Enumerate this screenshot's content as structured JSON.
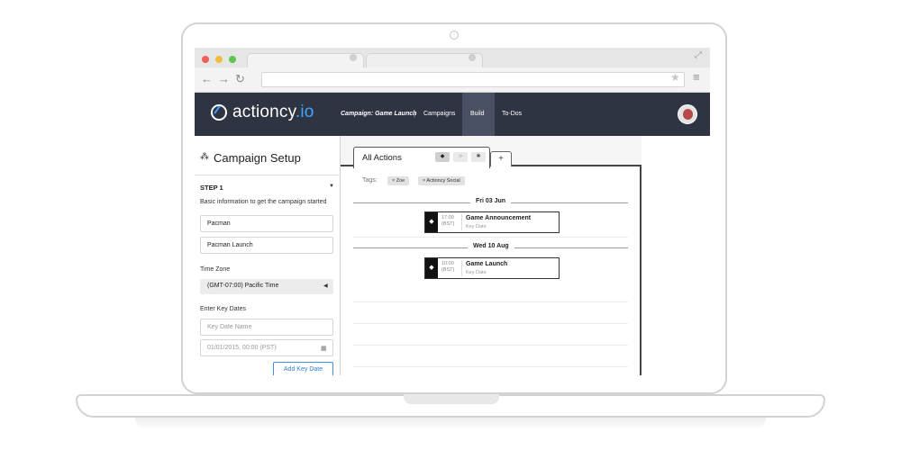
{
  "browser": {
    "nav": {
      "back": "←",
      "forward": "→",
      "reload": "↻"
    },
    "icons": {
      "bookmark": "star-icon",
      "menu": "hamburger-icon",
      "expand": "expand-icon"
    }
  },
  "header": {
    "logo_main": "actioncy",
    "logo_suffix": ".io",
    "breadcrumb": "Campaign: Game Launch",
    "separator": "|",
    "nav": [
      "Campaigns",
      "Build",
      "To-Dos"
    ],
    "active_nav": "Build"
  },
  "sidebar": {
    "title": "Campaign Setup",
    "step_label": "STEP 1",
    "hint": "Basic information to get the campaign started",
    "fields": {
      "name_value": "Pacman",
      "campaign_value": "Pacman Launch"
    },
    "timezone_label": "Time Zone",
    "timezone_value": "(GMT-07:00) Pacific Time",
    "key_dates_label": "Enter Key Dates",
    "key_date_name_placeholder": "Key Date Name",
    "key_date_datetime_placeholder": "01/01/2015, 00:00 (PST)",
    "add_button": "Add Key Date"
  },
  "main": {
    "tab_title": "All Actions",
    "tab_plus": "+",
    "tags_label": "Tags:",
    "tags": [
      "× Zoe",
      "× Actioncy Social"
    ],
    "groups": [
      {
        "date": "Fri 03 Jun",
        "actions": [
          {
            "time": "17:00",
            "zone": "(BST)",
            "title": "Game Announcement",
            "type": "Key Date"
          }
        ]
      },
      {
        "date": "Wed 10 Aug",
        "actions": [
          {
            "time": "10:00",
            "zone": "(BST)",
            "title": "Game Launch",
            "type": "Key Date"
          }
        ]
      }
    ]
  },
  "colors": {
    "header_bg": "#2f3442",
    "active_nav_bg": "#4a5063",
    "accent": "#3fa6ff",
    "button_blue": "#2f7fd4"
  }
}
